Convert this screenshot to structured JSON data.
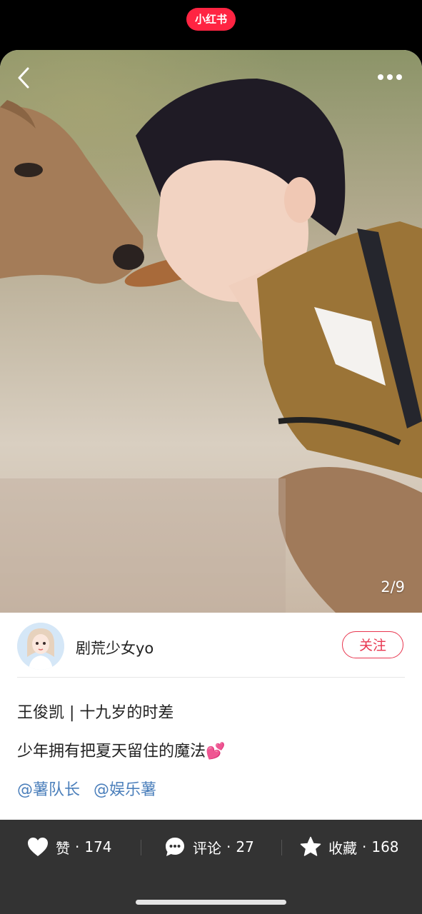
{
  "app": {
    "logo_text": "小红书",
    "brand_color": "#ff2442"
  },
  "photo": {
    "page_indicator": "2/9"
  },
  "author": {
    "name": "剧荒少女yo",
    "follow_label": "关注"
  },
  "post": {
    "title": "王俊凯 | 十九岁的时差",
    "body": "少年拥有把夏天留住的魔法",
    "emoji": "💕",
    "tags": [
      "@薯队长",
      "@娱乐薯"
    ]
  },
  "actions": {
    "like": {
      "label": "赞",
      "count": "174"
    },
    "comment": {
      "label": "评论",
      "count": "27"
    },
    "collect": {
      "label": "收藏",
      "count": "168"
    },
    "dot": "·"
  },
  "colors": {
    "tag": "#4b7fbb",
    "follow": "#e8364f",
    "bottom_bar": "#333333"
  }
}
